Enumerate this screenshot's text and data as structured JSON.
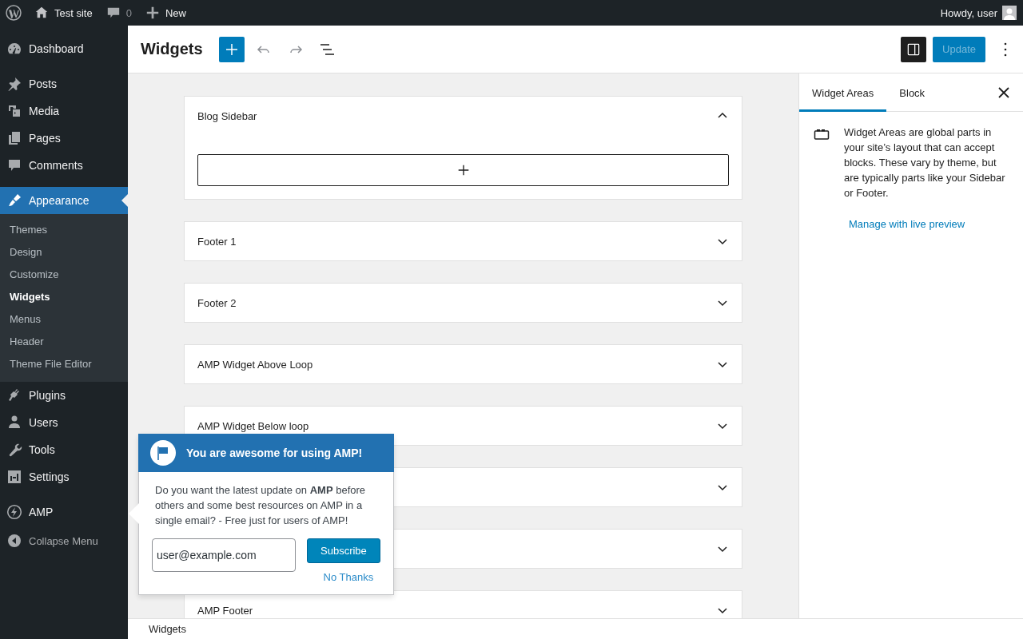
{
  "admin_bar": {
    "site": "Test site",
    "comments": "0",
    "new": "New",
    "greeting": "Howdy, user"
  },
  "menu": {
    "groups": [
      [
        {
          "label": "Dashboard",
          "selected": false
        }
      ],
      [
        {
          "label": "Posts",
          "selected": false
        },
        {
          "label": "Media",
          "selected": false
        },
        {
          "label": "Pages",
          "selected": false
        },
        {
          "label": "Comments",
          "selected": false
        }
      ],
      [
        {
          "label": "Appearance",
          "selected": true,
          "children": [
            {
              "label": "Themes",
              "selected": false
            },
            {
              "label": "Design",
              "selected": false
            },
            {
              "label": "Customize",
              "selected": false
            },
            {
              "label": "Widgets",
              "selected": true
            },
            {
              "label": "Menus",
              "selected": false
            },
            {
              "label": "Header",
              "selected": false
            },
            {
              "label": "Theme File Editor",
              "selected": false
            }
          ]
        },
        {
          "label": "Plugins",
          "selected": false
        },
        {
          "label": "Users",
          "selected": false
        },
        {
          "label": "Tools",
          "selected": false
        },
        {
          "label": "Settings",
          "selected": false
        }
      ],
      [
        {
          "label": "AMP",
          "selected": false
        }
      ]
    ],
    "collapse": "Collapse Menu"
  },
  "header": {
    "title": "Widgets",
    "update": {
      "label": "Update",
      "disabled": true
    }
  },
  "widget_areas": [
    {
      "title": "Blog Sidebar",
      "expanded": true
    },
    {
      "title": "Footer 1",
      "expanded": false
    },
    {
      "title": "Footer 2",
      "expanded": false
    },
    {
      "title": "AMP Widget Above Loop",
      "expanded": false
    },
    {
      "title": "AMP Widget Below loop",
      "expanded": false
    },
    {
      "expanded": false
    },
    {
      "expanded": false
    },
    {
      "title": "AMP Footer",
      "expanded": false
    }
  ],
  "settings_panel": {
    "tabs": [
      {
        "label": "Widget Areas",
        "selected": true
      },
      {
        "label": "Block",
        "selected": false
      }
    ],
    "description": "Widget Areas are global parts in your site’s layout that can accept blocks. These vary by theme, but are typically parts like your Sidebar or Footer.",
    "link": "Manage with live preview"
  },
  "popup": {
    "title": "You are awesome for using AMP!",
    "body": "Do you want the latest update on **AMP** before others and some best resources on AMP in a single email? - Free just for users of AMP!",
    "email": "user@example.com",
    "subscribe": "Subscribe",
    "dismiss": "No Thanks"
  },
  "footer": {
    "breadcrumb": "Widgets"
  }
}
